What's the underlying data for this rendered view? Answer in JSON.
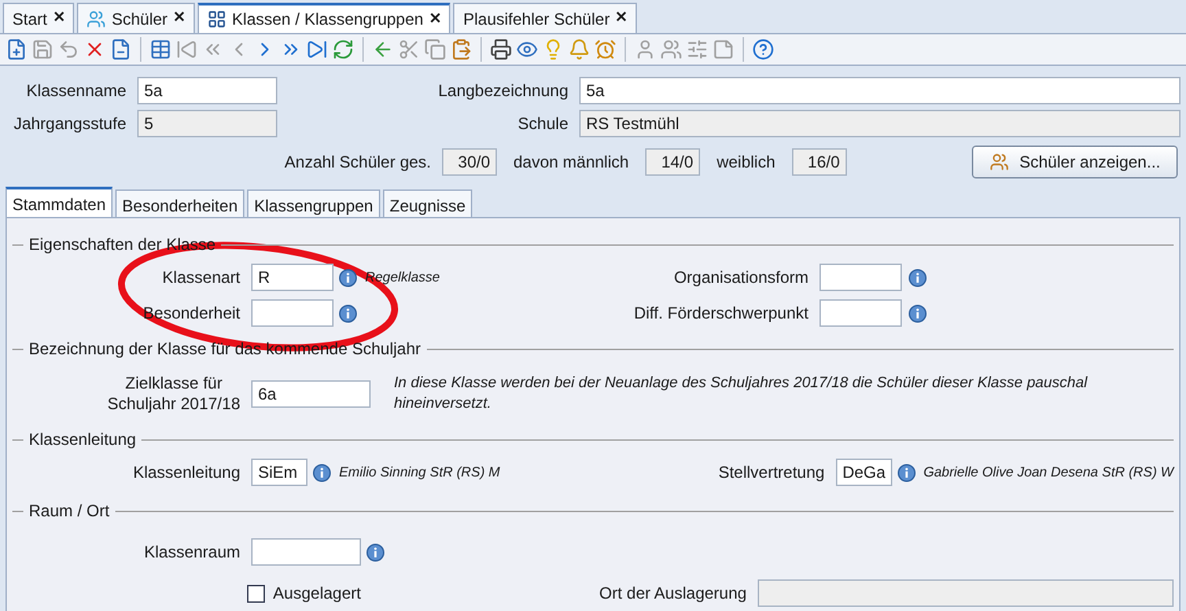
{
  "doc_tabs": [
    {
      "label": "Start",
      "close": "✕",
      "selected": false
    },
    {
      "label": "Schüler",
      "close": "✕",
      "selected": false
    },
    {
      "label": "Klassen / Klassengruppen",
      "close": "✕",
      "selected": true
    },
    {
      "label": "Plausifehler Schüler",
      "close": "✕",
      "selected": false
    }
  ],
  "toolbar": [
    {
      "kind": "new",
      "disabled": false
    },
    {
      "kind": "save",
      "disabled": true
    },
    {
      "kind": "undo",
      "disabled": true
    },
    {
      "kind": "delete",
      "disabled": false
    },
    {
      "kind": "remove",
      "disabled": false
    },
    {
      "kind": "sep"
    },
    {
      "kind": "table",
      "disabled": false
    },
    {
      "kind": "first",
      "disabled": true
    },
    {
      "kind": "prevprev",
      "disabled": true
    },
    {
      "kind": "prev",
      "disabled": true
    },
    {
      "kind": "next",
      "disabled": false
    },
    {
      "kind": "nextnext",
      "disabled": false
    },
    {
      "kind": "last",
      "disabled": false
    },
    {
      "kind": "refresh",
      "disabled": false
    },
    {
      "kind": "sep"
    },
    {
      "kind": "back",
      "disabled": false
    },
    {
      "kind": "cut",
      "disabled": true
    },
    {
      "kind": "copy",
      "disabled": true
    },
    {
      "kind": "paste",
      "disabled": false
    },
    {
      "kind": "sep"
    },
    {
      "kind": "print",
      "disabled": false
    },
    {
      "kind": "view",
      "disabled": false
    },
    {
      "kind": "idea",
      "disabled": false
    },
    {
      "kind": "bell",
      "disabled": false
    },
    {
      "kind": "clock",
      "disabled": false
    },
    {
      "kind": "sep"
    },
    {
      "kind": "user",
      "disabled": true
    },
    {
      "kind": "users",
      "disabled": true
    },
    {
      "kind": "sliders",
      "disabled": true
    },
    {
      "kind": "note",
      "disabled": true
    },
    {
      "kind": "sep"
    },
    {
      "kind": "help",
      "disabled": false
    }
  ],
  "header": {
    "klassenname": {
      "label": "Klassenname",
      "value": "5a"
    },
    "langbezeichnung": {
      "label": "Langbezeichnung",
      "value": "5a"
    },
    "jahrgangsstufe": {
      "label": "Jahrgangsstufe",
      "value": "5"
    },
    "schule": {
      "label": "Schule",
      "value": "RS Testmühl"
    },
    "counts": [
      {
        "label": "Anzahl Schüler ges.",
        "value": "30/0"
      },
      {
        "label": "davon männlich",
        "value": "14/0"
      },
      {
        "label": "weiblich",
        "value": "16/0"
      }
    ],
    "button": "Schüler anzeigen..."
  },
  "tabs": [
    {
      "label": "Stammdaten",
      "selected": true
    },
    {
      "label": "Besonderheiten",
      "selected": false
    },
    {
      "label": "Klassengruppen",
      "selected": false
    },
    {
      "label": "Zeugnisse",
      "selected": false
    }
  ],
  "eigenschaften": {
    "title": "Eigenschaften der Klasse",
    "klassenart": {
      "label": "Klassenart",
      "value": "R",
      "note": "Regelklasse"
    },
    "besonderheit": {
      "label": "Besonderheit"
    },
    "organisationsform": {
      "label": "Organisationsform"
    },
    "foerderschwerpunkt": {
      "label": "Diff. Förderschwerpunkt"
    }
  },
  "bezeichnung": {
    "title": "Bezeichnung der Klasse für das kommende Schuljahr",
    "label_lines": [
      "Zielklasse für",
      "Schuljahr 2017/18"
    ],
    "value": "6a",
    "note": "In diese Klasse werden bei der Neuanlage des Schuljahres 2017/18 die Schüler dieser Klasse pauschal hineinversetzt."
  },
  "klassenleitung": {
    "title": "Klassenleitung",
    "leitung": {
      "label": "Klassenleitung",
      "value": "SiEm",
      "note": "Emilio Sinning StR (RS) M"
    },
    "vertretung": {
      "label": "Stellvertretung",
      "value": "DeGa",
      "note": "Gabrielle Olive Joan Desena StR (RS) W"
    }
  },
  "raum": {
    "title": "Raum / Ort",
    "klassenraum": {
      "label": "Klassenraum"
    },
    "ausgelagert": {
      "label": "Ausgelagert",
      "checked": false
    },
    "ort": {
      "label": "Ort der Auslagerung"
    }
  }
}
